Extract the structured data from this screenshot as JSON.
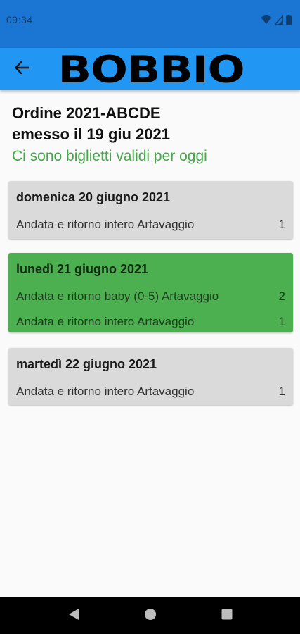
{
  "status_bar": {
    "time": "09:34",
    "icons": [
      "wifi-icon",
      "signal-icon",
      "battery-icon"
    ]
  },
  "app_bar": {
    "logo": "BOBBIO",
    "back_icon": "arrow-left-icon"
  },
  "order": {
    "title": "Ordine 2021-ABCDE",
    "issued": "emesso il 19 giu 2021",
    "valid_message": "Ci sono biglietti validi per oggi"
  },
  "days": [
    {
      "date": "domenica 20 giugno 2021",
      "highlighted": false,
      "tickets": [
        {
          "name": "Andata e ritorno intero Artavaggio",
          "qty": "1"
        }
      ]
    },
    {
      "date": "lunedì 21 giugno 2021",
      "highlighted": true,
      "tickets": [
        {
          "name": "Andata e ritorno baby (0-5) Artavaggio",
          "qty": "2"
        },
        {
          "name": "Andata e ritorno intero Artavaggio",
          "qty": "1"
        }
      ]
    },
    {
      "date": "martedì 22 giugno 2021",
      "highlighted": false,
      "tickets": [
        {
          "name": "Andata e ritorno intero Artavaggio",
          "qty": "1"
        }
      ]
    }
  ],
  "nav_bar": {
    "icons": [
      "back-triangle-icon",
      "home-circle-icon",
      "recents-square-icon"
    ]
  },
  "colors": {
    "status_bar": "#1a76d2",
    "app_bar": "#2196f3",
    "valid_text": "#43a947",
    "card_grey": "#dadada",
    "card_green": "#4caf50"
  }
}
